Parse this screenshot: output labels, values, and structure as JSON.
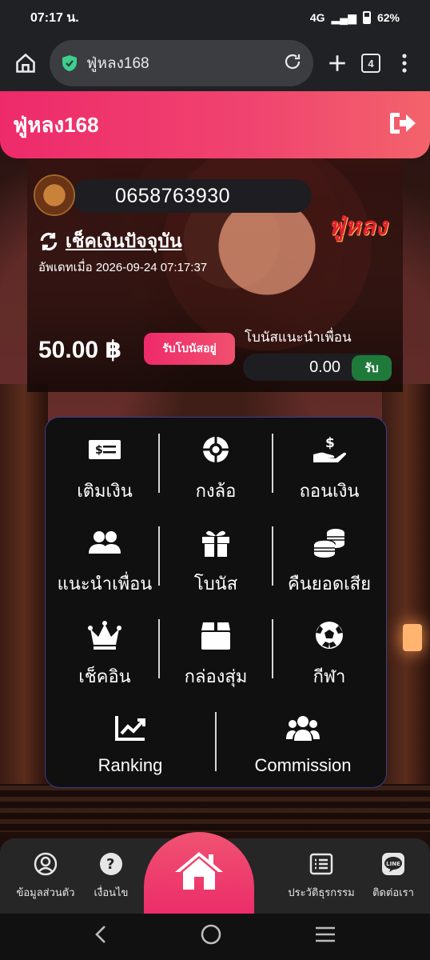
{
  "status_bar": {
    "time": "07:17 น.",
    "network": "4G",
    "battery": "62%"
  },
  "browser": {
    "url": "ฟู่หลง168",
    "tab_count": "4"
  },
  "header": {
    "brand": "ฟู่หลง168"
  },
  "profile": {
    "phone": "0658763930",
    "check_balance_label": "เช็คเงินปัจจุบัน",
    "updated_text": "อัพเดทเมื่อ 2026-09-24 07:17:37",
    "logo_text": "ฟู่หลง",
    "balance": "50.00 ฿",
    "bonus_button": "รับโบนัสอยู่",
    "referral_label": "โบนัสแนะนำเพื่อน",
    "referral_value": "0.00",
    "referral_button": "รับ"
  },
  "menu": {
    "items": [
      {
        "label": "เติมเงิน",
        "icon": "money-bill-icon"
      },
      {
        "label": "กงล้อ",
        "icon": "wheel-icon"
      },
      {
        "label": "ถอนเงิน",
        "icon": "hand-dollar-icon"
      },
      {
        "label": "แนะนำเพื่อน",
        "icon": "users-icon"
      },
      {
        "label": "โบนัส",
        "icon": "gift-icon"
      },
      {
        "label": "คืนยอดเสีย",
        "icon": "coins-icon"
      },
      {
        "label": "เช็คอิน",
        "icon": "crown-icon"
      },
      {
        "label": "กล่องสุ่ม",
        "icon": "box-icon"
      },
      {
        "label": "กีฬา",
        "icon": "soccer-ball-icon"
      },
      {
        "label": "Ranking",
        "icon": "chart-line-icon"
      },
      {
        "label": "Commission",
        "icon": "group-icon"
      }
    ]
  },
  "bottom_nav": {
    "profile": "ข้อมูลส่วนตัว",
    "terms": "เงื่อนไข",
    "history": "ประวัติธุรกรรม",
    "contact": "ติดต่อเรา",
    "line_badge": "LINE"
  },
  "colors": {
    "accent": "#ee2a6b",
    "green": "#1f7a3a",
    "panel": "#101010",
    "panel_border": "#3b3f8a"
  }
}
